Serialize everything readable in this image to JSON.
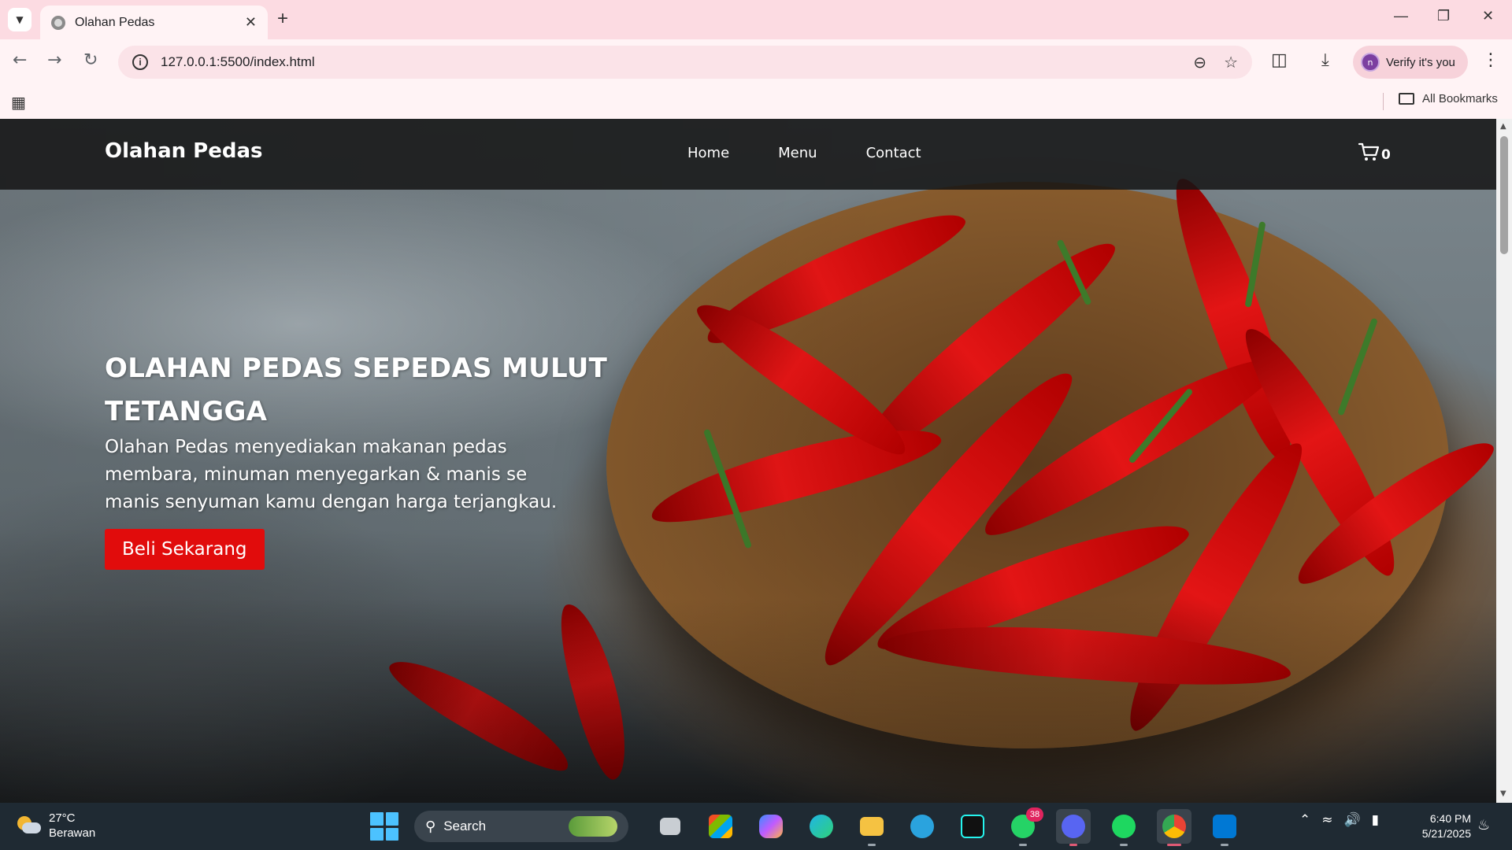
{
  "browser": {
    "tab_title": "Olahan Pedas",
    "url": "127.0.0.1:5500/index.html",
    "profile_label": "Verify it's you",
    "profile_initial": "n",
    "bookmarks_label": "All Bookmarks"
  },
  "site": {
    "brand": "Olahan Pedas",
    "nav": [
      "Home",
      "Menu",
      "Contact"
    ],
    "cart_count": "0",
    "hero_title_line1": "OLAHAN PEDAS SEPEDAS MULUT",
    "hero_title_line2": "TETANGGA",
    "hero_desc_line1": "Olahan Pedas menyediakan makanan pedas",
    "hero_desc_line2": "membara, minuman menyegarkan & manis se",
    "hero_desc_line3": "manis senyuman kamu dengan harga terjangkau.",
    "cta_label": "Beli Sekarang"
  },
  "taskbar": {
    "temperature": "27°C",
    "weather": "Berawan",
    "search_label": "Search",
    "whatsapp_badge": "38",
    "time": "6:40 PM",
    "date": "5/21/2025"
  },
  "colors": {
    "accent_red": "#e10c0c",
    "tab_bar": "#fcdbe2",
    "nav_dark": "#141414"
  }
}
